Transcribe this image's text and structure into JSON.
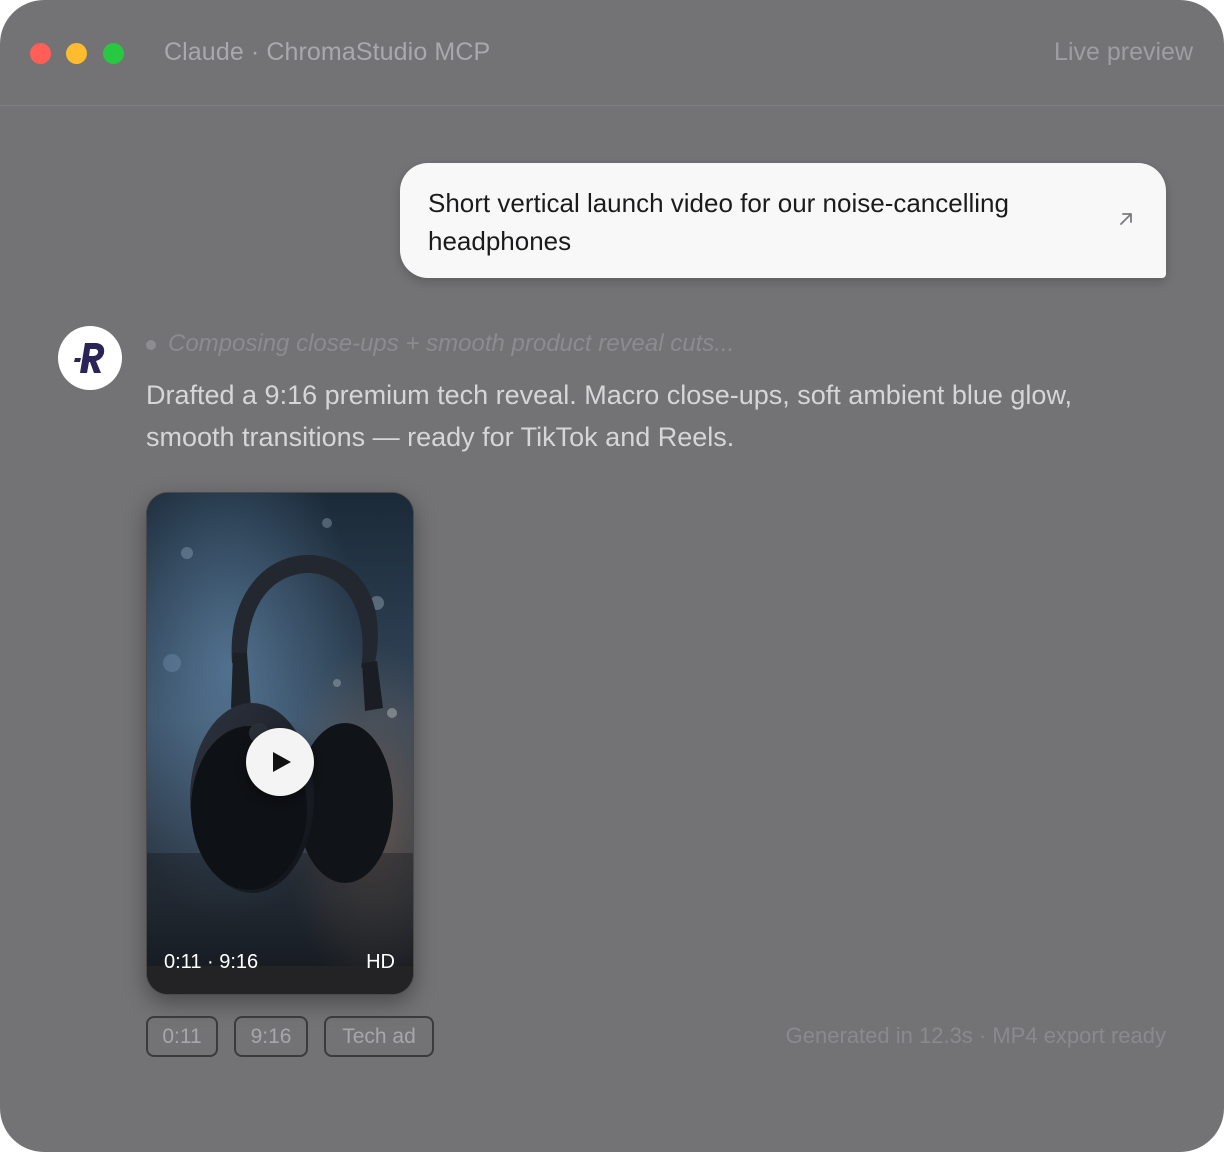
{
  "window": {
    "title": "Claude · ChromaStudio MCP",
    "mode_label": "Live preview"
  },
  "user_message": {
    "text": "Short vertical launch video for our noise-cancelling headphones",
    "icon": "arrow-up-right-icon"
  },
  "assistant": {
    "avatar_letter": "R",
    "status": "Composing close-ups + smooth product reveal cuts...",
    "message": "Drafted a 9:16 premium tech reveal. Macro close-ups, soft ambient blue glow, smooth transitions — ready for TikTok and Reels."
  },
  "video": {
    "timecode": "0:11 · 9:16",
    "quality": "HD",
    "play_icon": "play-icon"
  },
  "tags": [
    "0:11",
    "9:16",
    "Tech ad"
  ],
  "footer_note": "Generated in 12.3s · MP4 export ready",
  "colors": {
    "window_bg": "#737375",
    "bubble_bg": "#f8f8f8",
    "traffic_red": "#ff5f57",
    "traffic_yellow": "#febc2e",
    "traffic_green": "#28c840",
    "avatar_accent": "#2b2457"
  }
}
